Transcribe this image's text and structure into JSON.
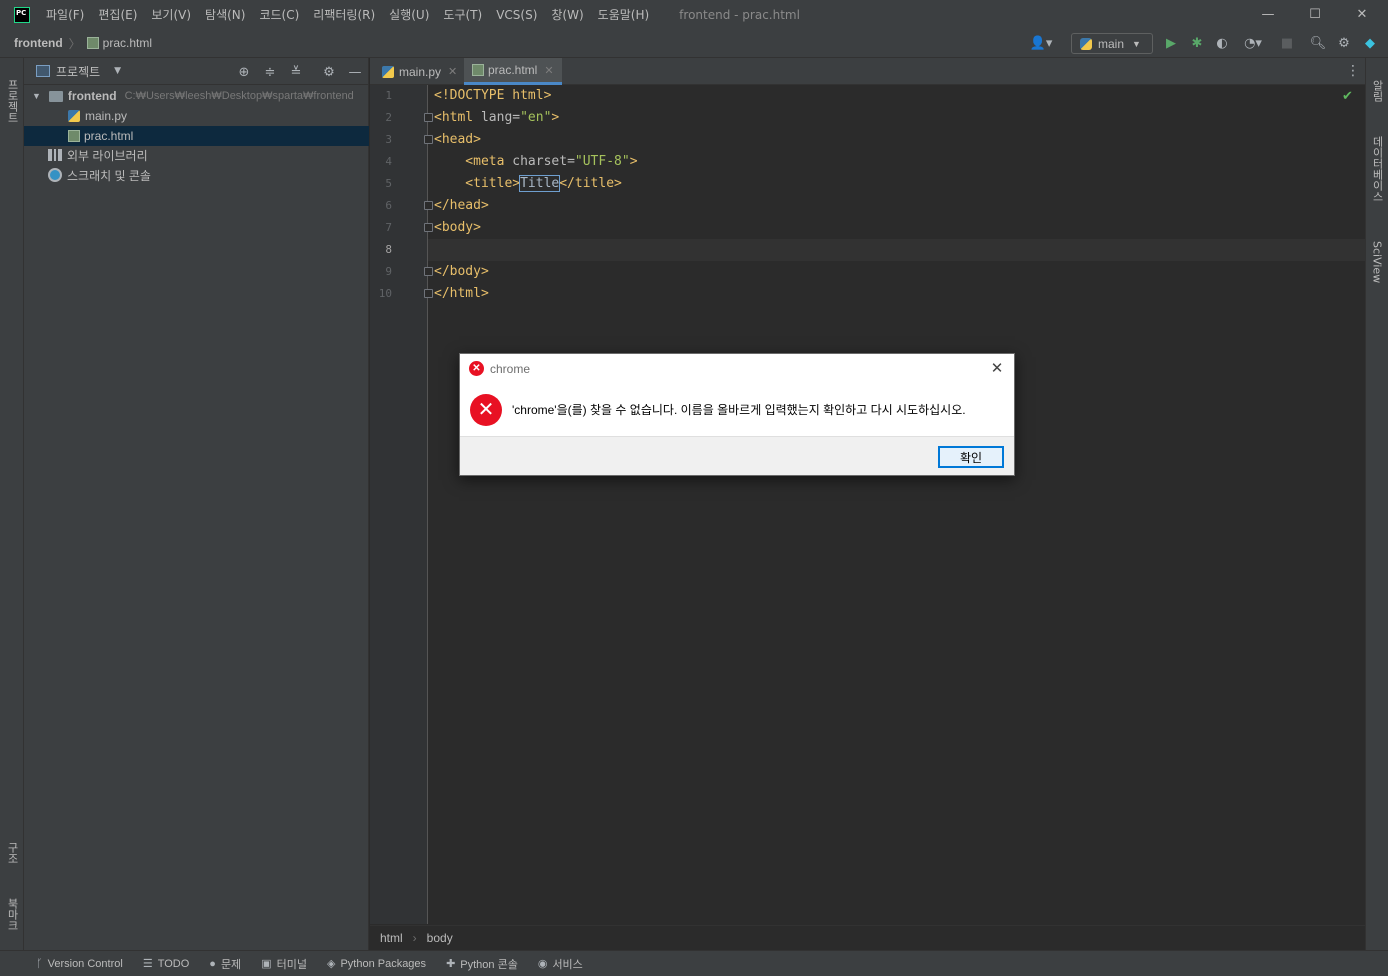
{
  "app": {
    "logo_text": "PC",
    "window_title": "frontend - prac.html"
  },
  "menu": [
    "파일(F)",
    "편집(E)",
    "보기(V)",
    "탐색(N)",
    "코드(C)",
    "리팩터링(R)",
    "실행(U)",
    "도구(T)",
    "VCS(S)",
    "창(W)",
    "도움말(H)"
  ],
  "window_controls": {
    "minimize": "—",
    "maximize": "☐",
    "close": "✕"
  },
  "navbar": {
    "project": "frontend",
    "separator": "〉",
    "file": "prac.html",
    "run_config": "main"
  },
  "left_stripe": {
    "project_label": "프로젝트",
    "structure_label": "구조",
    "bookmarks_label": "북마크"
  },
  "project_panel": {
    "title": "프로젝트",
    "tree": [
      {
        "label": "frontend",
        "path": "C:₩Users₩leesh₩Desktop₩sparta₩frontend",
        "type": "folder"
      },
      {
        "label": "main.py",
        "type": "py"
      },
      {
        "label": "prac.html",
        "type": "html",
        "selected": true
      },
      {
        "label": "외부 라이브러리",
        "type": "lib"
      },
      {
        "label": "스크래치 및 콘솔",
        "type": "scratch"
      }
    ]
  },
  "tabs": [
    {
      "label": "main.py",
      "active": false
    },
    {
      "label": "prac.html",
      "active": true
    }
  ],
  "editor": {
    "line_numbers": [
      "1",
      "2",
      "3",
      "4",
      "5",
      "6",
      "7",
      "8",
      "9",
      "10"
    ],
    "current_line": "8",
    "lines": {
      "l1": "<!DOCTYPE html>",
      "l2_open": "<html ",
      "l2_attr": "lang=",
      "l2_val": "\"en\"",
      "l2_close": ">",
      "l3": "<head>",
      "l4_open": "    <meta ",
      "l4_attr": "charset=",
      "l4_val": "\"UTF-8\"",
      "l4_close": ">",
      "l5_open": "    <title>",
      "l5_text": "Title",
      "l5_close": "</title>",
      "l6": "</head>",
      "l7": "<body>",
      "l8": "",
      "l9": "</body>",
      "l10": "</html>"
    }
  },
  "right_stripe": {
    "notifications_label": "알림",
    "database_label": "데이터베이스",
    "sciview_label": "SciView"
  },
  "editor_breadcrumbs": [
    "html",
    "body"
  ],
  "bottom_bar": [
    {
      "label": "Version Control",
      "icon": "branch-icon"
    },
    {
      "label": "TODO",
      "icon": "list-icon"
    },
    {
      "label": "문제",
      "icon": "problem-icon"
    },
    {
      "label": "터미널",
      "icon": "terminal-icon"
    },
    {
      "label": "Python Packages",
      "icon": "packages-icon"
    },
    {
      "label": "Python 콘솔",
      "icon": "python-console-icon"
    },
    {
      "label": "서비스",
      "icon": "services-icon"
    }
  ],
  "dialog": {
    "title": "chrome",
    "message": "'chrome'을(를) 찾을 수 없습니다. 이름을 올바르게 입력했는지 확인하고 다시 시도하십시오.",
    "ok_label": "확인"
  },
  "colors": {
    "accent": "#4a88c7",
    "tag": "#e8bf6a",
    "string": "#a5c25c",
    "error": "#e81123",
    "selection": "#0d293e"
  }
}
